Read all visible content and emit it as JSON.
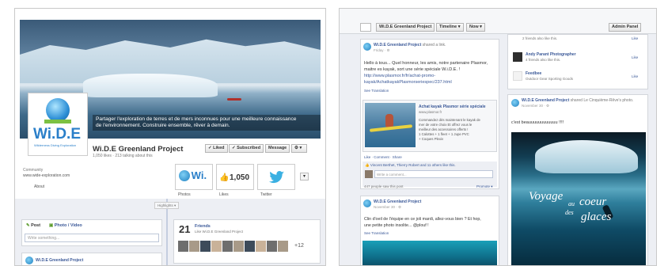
{
  "left": {
    "cover_caption_line1": "Partager l'exploration de terres et de mers inconnues pour une meilleure connaissance",
    "cover_caption_line2": "de l'environnement. Construire ensemble, rêver à demain.",
    "logo_text": "Wi.D.E",
    "logo_sub": "Wilderness Diving Exploration",
    "page_name": "Wi.D.E Greenland Project",
    "page_stats": "1,050 likes · 213 talking about this",
    "liked_label": "✓ Liked",
    "subscribed_label": "✓ Subscribed",
    "message_label": "Message",
    "category": "Community",
    "website": "www.wide-exploration.com",
    "about_label": "About",
    "tabs": [
      {
        "label": "Photos"
      },
      {
        "label": "Likes",
        "count": "1,050"
      },
      {
        "label": "Twitter"
      }
    ],
    "mini_logo": "Wi.",
    "timeline_marker": "Highlights ▾",
    "composer_tab_post": "Post",
    "composer_tab_photo": "Photo / Video",
    "composer_placeholder": "Write something...",
    "friends_count": "21",
    "friends_label": "Friends",
    "friends_sub": "Like Wi.D.E Greenland Project",
    "friends_more": "+12",
    "post_author": "Wi.D.E Greenland Project"
  },
  "right": {
    "topbar_page": "Wi.D.E Greenland Project",
    "topbar_timeline": "Timeline ▾",
    "topbar_now": "Now ▾",
    "admin_panel": "Admin Panel",
    "post1_author": "Wi.D.E Greenland Project",
    "post1_shared": "shared a link.",
    "post1_meta": "Friday · ⚙",
    "post1_text1": "Hello à tous... Quel honneur, les amis, notre partenaire Plasmor,",
    "post1_text2": "maitre es kayak, sort une série spéciale W.i.D.E. !",
    "post1_link1": "http://www.plasmor.fr/fr/achat-promo-",
    "post1_link2": "kayak/AchatkayakPlasmorseriespec/237.html",
    "see_translation": "See Translation",
    "link_title": "Achat kayak Plasmor série spéciale",
    "link_domain": "www.plasmor.fr",
    "link_desc1": "Commandez dès maintenant le kayak de",
    "link_desc2": "mer de votre choix Et offrez vous le",
    "link_desc3": "meilleur des accessoires offerts !",
    "link_desc4": "1 Calottes + 1 fleet + 1 Jupe PVC",
    "link_desc5": "+ Coques Plexiv",
    "actions": "Like · Comment · Share",
    "likes_line": "Vincent Berthet, Thierry Robert and 11 others like this.",
    "comment_placeholder": "Write a comment...",
    "seen_by": "447 people saw this post",
    "promote": "Promote ▾",
    "post2_author": "Wi.D.E Greenland Project",
    "post2_meta": "November 30 · ⚙",
    "post2_text1": "Clin d'oeil de l'équipe en ce joli mardi, allez-vous bien ? Et hop,",
    "post2_text2": "une petite photo insolite... @plouf !",
    "side_top_line": "2 friends also like this.",
    "side_items": [
      {
        "name": "Andy Parant Photographer",
        "sub": "4 friends also like this.",
        "like": "Like"
      },
      {
        "name": "Feedbee",
        "sub": "Outdoor Gear Sporting Goods",
        "like": "Like"
      }
    ],
    "side_like_top": "Like",
    "post3_author": "Wi.D.E Greenland Project",
    "post3_shared": "shared Le Cinquième-Rêve's photo.",
    "post3_meta": "November 30 · ⚙",
    "post3_text": "c'est beauuuuuuuuuuuu !!!!",
    "poster_title1": "Voyage",
    "poster_title2": "au",
    "poster_title3": "coeur",
    "poster_title4": "des",
    "poster_title5": "glaces"
  }
}
